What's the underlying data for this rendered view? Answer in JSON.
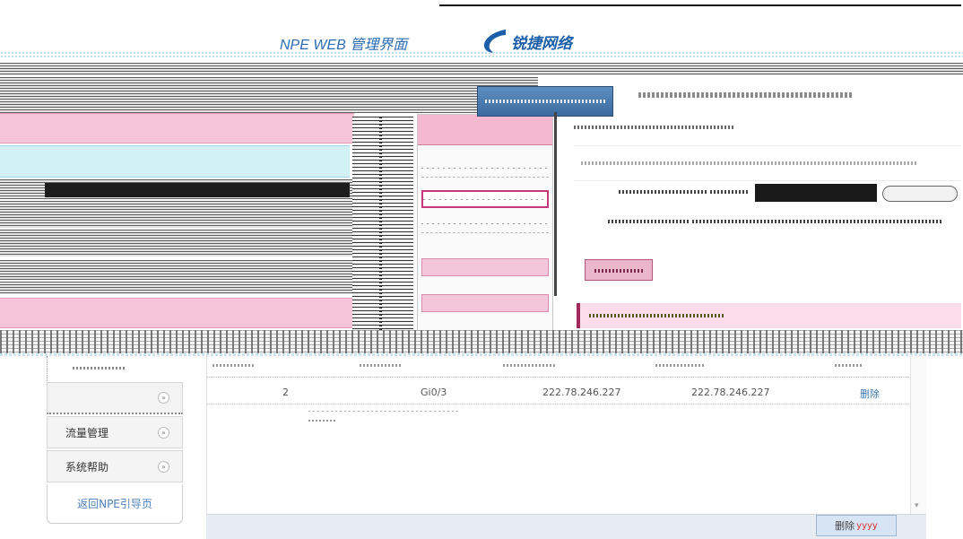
{
  "header": {
    "app_title": "NPE WEB 管理界面",
    "brand_name": "锐捷网络",
    "brand_color": "#1c5fa8",
    "accent_pink": "#f6c4d8",
    "accent_cyan": "#d2f1f6"
  },
  "sidebar": {
    "items": [
      {
        "label": "",
        "icon": "chevron-down-icon"
      },
      {
        "label": "流量管理",
        "icon": "chevron-down-icon"
      },
      {
        "label": "系统帮助",
        "icon": "chevron-down-icon"
      }
    ],
    "return_label": "返回NPE引导页"
  },
  "table": {
    "rows": [
      {
        "index": "2",
        "interface": "Gi0/3",
        "start_ip": "222.78.246.227",
        "end_ip": "222.78.246.227",
        "action": "删除"
      }
    ]
  },
  "footer": {
    "delete_label": "删除",
    "delete_suffix": "yyyy"
  }
}
